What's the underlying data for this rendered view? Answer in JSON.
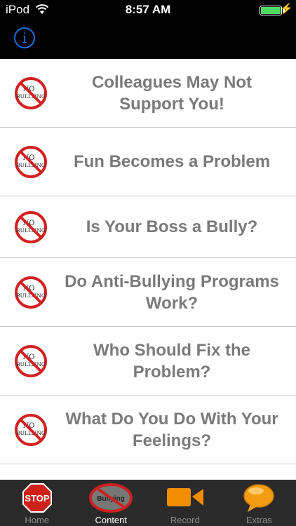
{
  "status_bar": {
    "carrier": "iPod",
    "time": "8:57 AM",
    "battery_level": 1.0
  },
  "nav_bar": {
    "info_label": "i"
  },
  "badge_text": {
    "line1": "NO",
    "line2": "BULLYING"
  },
  "list": {
    "items": [
      {
        "title": "Colleagues May Not Support You!"
      },
      {
        "title": "Fun Becomes a Problem"
      },
      {
        "title": "Is Your Boss a Bully?"
      },
      {
        "title": "Do Anti-Bullying Programs Work?"
      },
      {
        "title": "Who Should Fix the Problem?"
      },
      {
        "title": "What Do You Do With Your Feelings?"
      }
    ]
  },
  "tabs": [
    {
      "label": "Home",
      "icon": "stop-sign-icon",
      "icon_text": "STOP"
    },
    {
      "label": "Content",
      "icon": "no-bullying-icon",
      "icon_text": "Bullying"
    },
    {
      "label": "Record",
      "icon": "video-camera-icon"
    },
    {
      "label": "Extras",
      "icon": "speech-bubble-icon"
    }
  ],
  "colors": {
    "accent": "#1a6fe0",
    "battery": "#4cd964",
    "title_text": "#7a7a7a"
  }
}
